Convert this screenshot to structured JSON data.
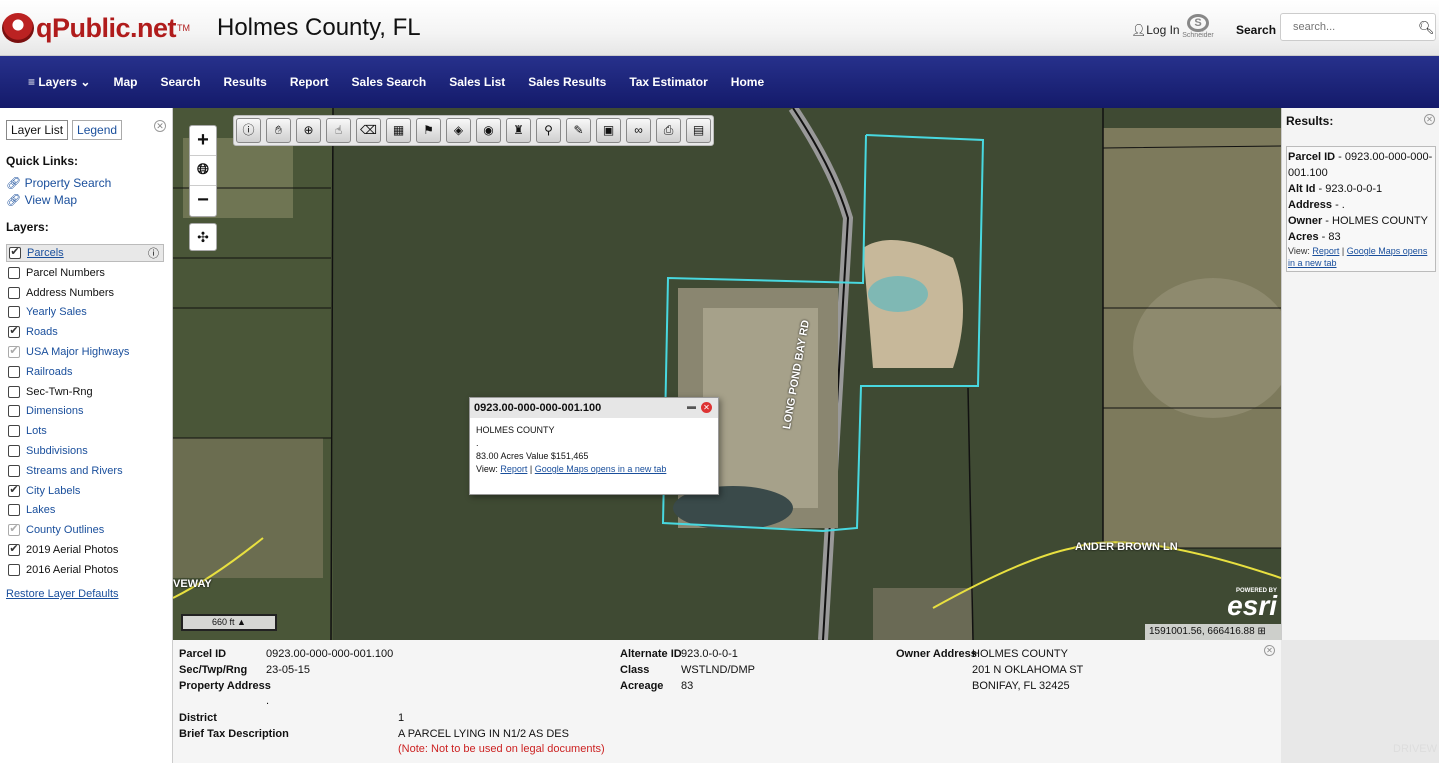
{
  "header": {
    "brand": "qPublic.net",
    "brand_tm": "TM",
    "county": "Holmes County, FL",
    "login": "Log In",
    "partner_logo": "Schneider",
    "search_label": "Search",
    "search_placeholder": "search..."
  },
  "nav": {
    "items": [
      "Layers",
      "Map",
      "Search",
      "Results",
      "Report",
      "Sales Search",
      "Sales List",
      "Sales Results",
      "Tax Estimator",
      "Home"
    ]
  },
  "sidebar": {
    "tabs": [
      "Layer List",
      "Legend"
    ],
    "quick_links_title": "Quick Links:",
    "quick_links": [
      "Property Search",
      "View Map"
    ],
    "layers_title": "Layers:",
    "layers": [
      {
        "label": "Parcels",
        "checked": true,
        "link": true
      },
      {
        "label": "Parcel Numbers",
        "checked": false,
        "link": false
      },
      {
        "label": "Address Numbers",
        "checked": false,
        "link": false
      },
      {
        "label": "Yearly Sales",
        "checked": false,
        "link": true
      },
      {
        "label": "Roads",
        "checked": true,
        "link": true
      },
      {
        "label": "USA Major Highways",
        "checked": true,
        "link": true,
        "dim": true
      },
      {
        "label": "Railroads",
        "checked": false,
        "link": true
      },
      {
        "label": "Sec-Twn-Rng",
        "checked": false,
        "link": false
      },
      {
        "label": "Dimensions",
        "checked": false,
        "link": true
      },
      {
        "label": "Lots",
        "checked": false,
        "link": true
      },
      {
        "label": "Subdivisions",
        "checked": false,
        "link": true
      },
      {
        "label": "Streams and Rivers",
        "checked": false,
        "link": true
      },
      {
        "label": "City Labels",
        "checked": true,
        "link": true
      },
      {
        "label": "Lakes",
        "checked": false,
        "link": true
      },
      {
        "label": "County Outlines",
        "checked": true,
        "link": true,
        "dim": true
      },
      {
        "label": "2019 Aerial Photos",
        "checked": true,
        "link": false
      },
      {
        "label": "2016 Aerial Photos",
        "checked": false,
        "link": false
      }
    ],
    "restore": "Restore Layer Defaults"
  },
  "map": {
    "popup": {
      "title": "0923.00-000-000-001.100",
      "owner": "HOLMES COUNTY",
      "dot": ".",
      "acres_value": "83.00 Acres  Value $151,465",
      "view_label": "View:",
      "report_link": "Report",
      "sep": "|",
      "maps_link": "Google Maps opens in a new tab"
    },
    "scale": "660 ft",
    "coords": "1591001.56, 666416.88",
    "esri_powered": "POWERED BY",
    "esri": "esri",
    "road_labels": [
      "ANDER BROWN LN",
      "VEWAY",
      "LONG POND BAY RD"
    ]
  },
  "results": {
    "title": "Results:",
    "parcel_id_label": "Parcel ID",
    "parcel_id": " - 0923.00-000-000-001.100",
    "alt_id_label": "Alt Id",
    "alt_id": " - 923.0-0-0-1",
    "address_label": "Address",
    "address": " - .",
    "owner_label": "Owner",
    "owner": " - HOLMES COUNTY",
    "acres_label": "Acres",
    "acres": " - 83",
    "view_label": "View:",
    "report_link": "Report",
    "sep": "|",
    "maps_link": "Google Maps opens in a new tab"
  },
  "details": {
    "parcel_id_label": "Parcel ID",
    "parcel_id": "0923.00-000-000-001.100",
    "sec_label": "Sec/Twp/Rng",
    "sec": "23-05-15",
    "prop_addr_label": "Property Address",
    "prop_addr": ".",
    "prop_addr2": ".",
    "alt_id_label": "Alternate ID",
    "alt_id": "923.0-0-0-1",
    "class_label": "Class",
    "class": "WSTLND/DMP",
    "acreage_label": "Acreage",
    "acreage": "83",
    "owner_addr_label": "Owner Address",
    "owner_1": "HOLMES COUNTY",
    "owner_2": "201 N OKLAHOMA ST",
    "owner_3": "BONIFAY, FL 32425",
    "district_label": "District",
    "district": "1",
    "brief_label": "Brief Tax Description",
    "brief": "A PARCEL LYING IN N1/2 AS DES",
    "note": "(Note: Not to be used on legal documents)",
    "watermark": "DRIVEW"
  }
}
